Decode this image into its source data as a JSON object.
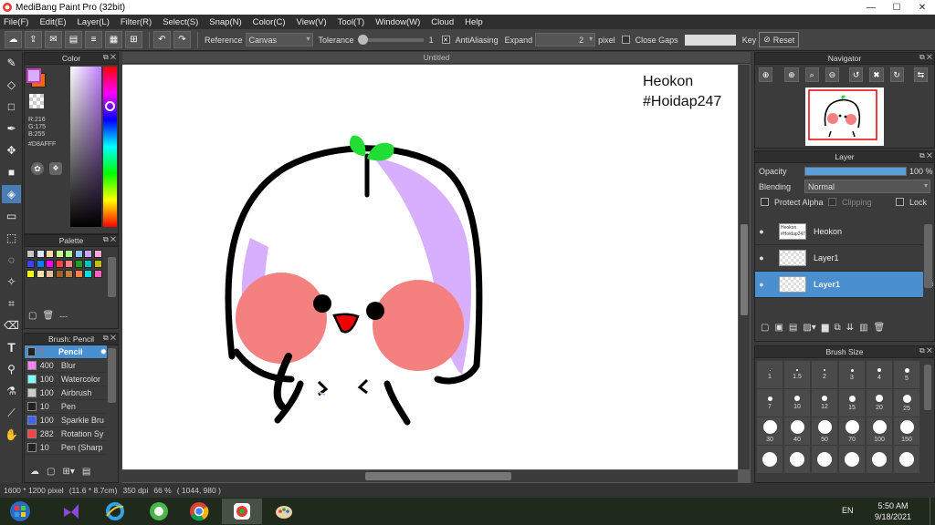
{
  "window": {
    "title": "MediBang Paint Pro (32bit)",
    "buttons": [
      "—",
      "☐",
      "✕"
    ]
  },
  "menu": [
    "File(F)",
    "Edit(E)",
    "Layer(L)",
    "Filter(R)",
    "Select(S)",
    "Snap(N)",
    "Color(C)",
    "View(V)",
    "Tool(T)",
    "Window(W)",
    "Cloud",
    "Help"
  ],
  "toolbar": {
    "reference_label": "Reference",
    "reference_value": "Canvas",
    "tolerance_label": "Tolerance",
    "tolerance_value": "1",
    "antialias_label": "AntiAliasing",
    "expand_label": "Expand",
    "expand_value": "2",
    "expand_unit": "pixel",
    "close_gaps_label": "Close Gaps",
    "key_label": "Key",
    "reset_label": "Reset"
  },
  "color_panel": {
    "title": "Color",
    "r": "R:216",
    "g": "G:175",
    "b": "B:255",
    "hex": "#D8AFFF",
    "primary_color": "#D8AFFF",
    "secondary_color": "#FF6600"
  },
  "palette_panel": {
    "title": "Palette",
    "footer_label": "---",
    "swatches": [
      "#c8c8c8",
      "#d8e8ff",
      "#ffd8a8",
      "#c8ff88",
      "#a8ff88",
      "#88c8ff",
      "#c8a8ff",
      "#ffa8d8",
      "#4040ff",
      "#0080ff",
      "#ff00ff",
      "#ff4040",
      "#ff8080",
      "#20a020",
      "#00c0c0",
      "#c0c000",
      "#ffff00",
      "#ffe0b0",
      "#e0c0a0",
      "#a06020",
      "#c08040",
      "#ff8040",
      "#00e0e0",
      "#ff60c0"
    ]
  },
  "brush_panel": {
    "title": "Brush: Pencil",
    "brushes": [
      {
        "size": "7",
        "name": "Pencil",
        "color": "#222222"
      },
      {
        "size": "400",
        "name": "Blur",
        "color": "#ff80ff"
      },
      {
        "size": "100",
        "name": "Watercolor",
        "color": "#80ffff"
      },
      {
        "size": "100",
        "name": "Airbrush",
        "color": "#cccccc"
      },
      {
        "size": "10",
        "name": "Pen",
        "color": "#222222"
      },
      {
        "size": "100",
        "name": "Sparkle Bru",
        "color": "#4060ff"
      },
      {
        "size": "282",
        "name": "Rotation Sy",
        "color": "#ff4040"
      },
      {
        "size": "10",
        "name": "Pen (Sharp",
        "color": "#222222"
      }
    ]
  },
  "document": {
    "tab": "Untitled"
  },
  "canvas_text": {
    "line1": "Heokon",
    "line2": "#Hoidap247"
  },
  "navigator": {
    "title": "Navigator"
  },
  "layer_panel": {
    "title": "Layer",
    "opacity_label": "Opacity",
    "opacity_value": "100 %",
    "opacity_fraction": 1.0,
    "blending_label": "Blending",
    "blending_value": "Normal",
    "protect_alpha": "Protect Alpha",
    "clipping": "Clipping",
    "lock": "Lock",
    "layers": [
      {
        "name": "Heokon",
        "selected": false
      },
      {
        "name": "Layer1",
        "selected": false
      },
      {
        "name": "Layer1",
        "selected": true
      }
    ]
  },
  "brush_size_panel": {
    "title": "Brush Size",
    "sizes": [
      "1",
      "1.5",
      "2",
      "3",
      "4",
      "5",
      "7",
      "10",
      "12",
      "15",
      "20",
      "25",
      "30",
      "40",
      "50",
      "70",
      "100",
      "150",
      "",
      "",
      "",
      "",
      "",
      ""
    ]
  },
  "status": {
    "dimensions": "1600 * 1200 pixel",
    "physical": "(11.6 * 8.7cm)",
    "dpi": "350 dpi",
    "zoom": "66 %",
    "cursor": "( 1044, 980 )"
  },
  "taskbar": {
    "lang": "EN",
    "time": "5:50 AM",
    "date": "9/18/2021"
  }
}
